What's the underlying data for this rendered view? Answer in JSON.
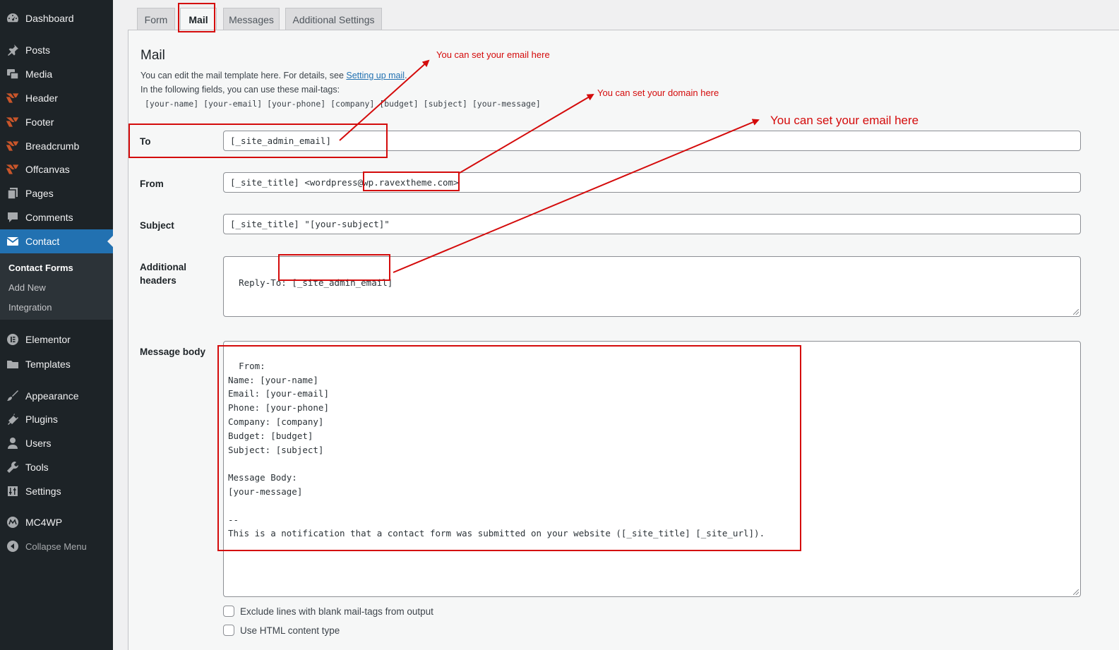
{
  "sidebar": {
    "dashboard": "Dashboard",
    "posts": "Posts",
    "media": "Media",
    "header": "Header",
    "footer": "Footer",
    "breadcrumb": "Breadcrumb",
    "offcanvas": "Offcanvas",
    "pages": "Pages",
    "comments": "Comments",
    "contact": "Contact",
    "contact_forms": "Contact Forms",
    "add_new": "Add New",
    "integration": "Integration",
    "elementor": "Elementor",
    "templates": "Templates",
    "appearance": "Appearance",
    "plugins": "Plugins",
    "users": "Users",
    "tools": "Tools",
    "settings": "Settings",
    "mc4wp": "MC4WP",
    "collapse": "Collapse Menu"
  },
  "tabs": {
    "form": "Form",
    "mail": "Mail",
    "messages": "Messages",
    "additional_settings": "Additional Settings"
  },
  "mail": {
    "title": "Mail",
    "desc_prefix": "You can edit the mail template here. For details, see ",
    "desc_link": "Setting up mail",
    "desc_suffix": ".",
    "desc_line2": "In the following fields, you can use these mail-tags:",
    "mail_tags": "[your-name] [your-email] [your-phone] [company] [budget] [subject] [your-message]",
    "to_label": "To",
    "to_value": "[_site_admin_email]",
    "from_label": "From",
    "from_value": "[_site_title] <wordpress@wp.ravextheme.com>",
    "subject_label": "Subject",
    "subject_value": "[_site_title] \"[your-subject]\"",
    "headers_label": "Additional headers",
    "headers_value": "Reply-To: [_site_admin_email]",
    "body_label": "Message body",
    "body_value": "From:\nName: [your-name]\nEmail: [your-email]\nPhone: [your-phone]\nCompany: [company]\nBudget: [budget]\nSubject: [subject]\n\nMessage Body:\n[your-message]\n\n--\nThis is a notification that a contact form was submitted on your website ([_site_title] [_site_url]).",
    "exclude_blank": "Exclude lines with blank mail-tags from output",
    "use_html": "Use HTML content type"
  },
  "annotations": {
    "note_to": "You can set your email here",
    "note_domain": "You can set your domain here",
    "note_reply": "You can set your email here"
  },
  "colors": {
    "sidebar_bg": "#1d2327",
    "accent": "#2271b1",
    "annotation": "#d40b0b"
  }
}
